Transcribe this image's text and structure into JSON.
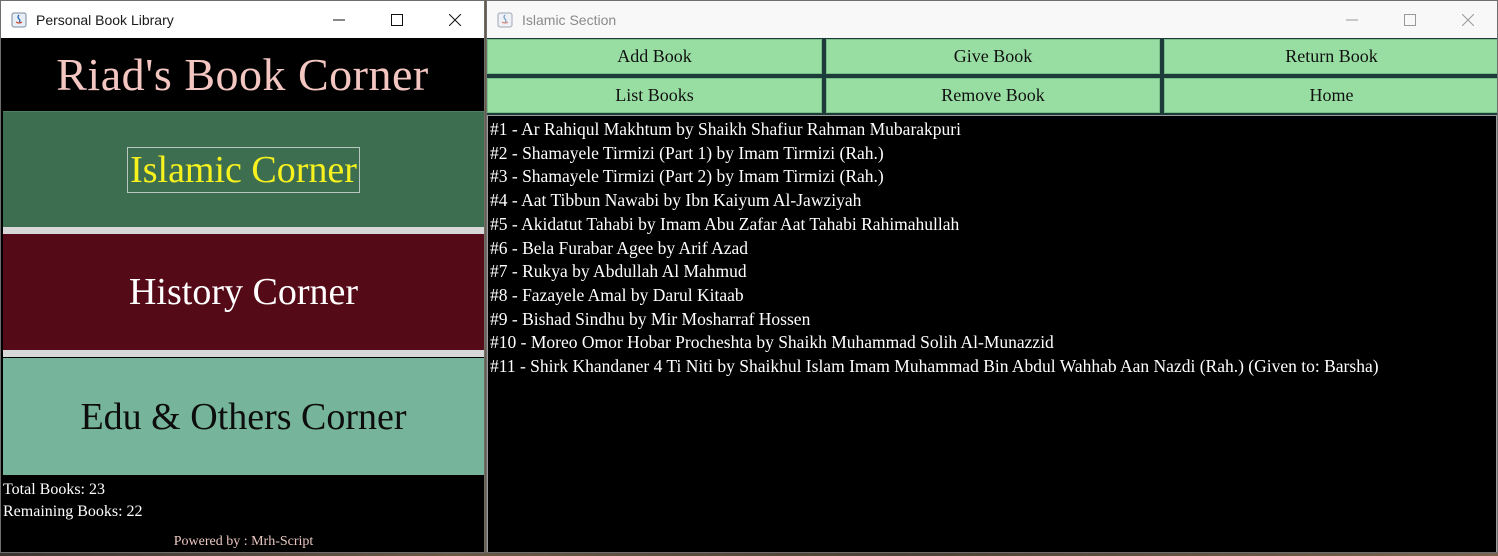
{
  "left_window": {
    "title": "Personal Book Library",
    "brand": "Riad's Book Corner",
    "corners": {
      "islamic": "Islamic Corner",
      "history": "History Corner",
      "edu": "Edu & Others Corner"
    },
    "total_books": "Total Books: 23",
    "remaining_books": "Remaining Books: 22",
    "powered_by": "Powered by : Mrh-Script"
  },
  "right_window": {
    "title": "Islamic Section",
    "buttons": {
      "add": "Add Book",
      "give": "Give Book",
      "return": "Return Book",
      "list": "List Books",
      "remove": "Remove Book",
      "home": "Home"
    },
    "books": [
      "#1 - Ar Rahiqul Makhtum by Shaikh Shafiur Rahman Mubarakpuri",
      "#2 - Shamayele Tirmizi (Part 1) by Imam Tirmizi (Rah.)",
      "#3 - Shamayele Tirmizi (Part 2) by Imam Tirmizi (Rah.)",
      "#4 - Aat Tibbun Nawabi by Ibn Kaiyum Al-Jawziyah",
      "#5 - Akidatut Tahabi by Imam Abu Zafar Aat Tahabi Rahimahullah",
      "#6 - Bela Furabar Agee by Arif Azad",
      "#7 - Rukya by Abdullah Al Mahmud",
      "#8 - Fazayele Amal by Darul Kitaab",
      "#9 - Bishad Sindhu by Mir Mosharraf Hossen",
      "#10 - Moreo Omor Hobar Procheshta by Shaikh Muhammad Solih Al-Munazzid",
      "#11 - Shirk Khandaner 4 Ti Niti by Shaikhul Islam Imam Muhammad Bin Abdul Wahhab Aan Nazdi (Rah.) (Given to: Barsha)"
    ]
  },
  "colors": {
    "islamic_bg": "#3e6e50",
    "islamic_text": "#f7f21e",
    "history_bg": "#550a17",
    "edu_bg": "#76b59c",
    "button_bg": "#98dea3",
    "brand_text": "#f3c6c1"
  },
  "icons": {
    "app": "java-app-icon",
    "minimize": "minimize-icon",
    "maximize": "maximize-icon",
    "close": "close-icon"
  }
}
